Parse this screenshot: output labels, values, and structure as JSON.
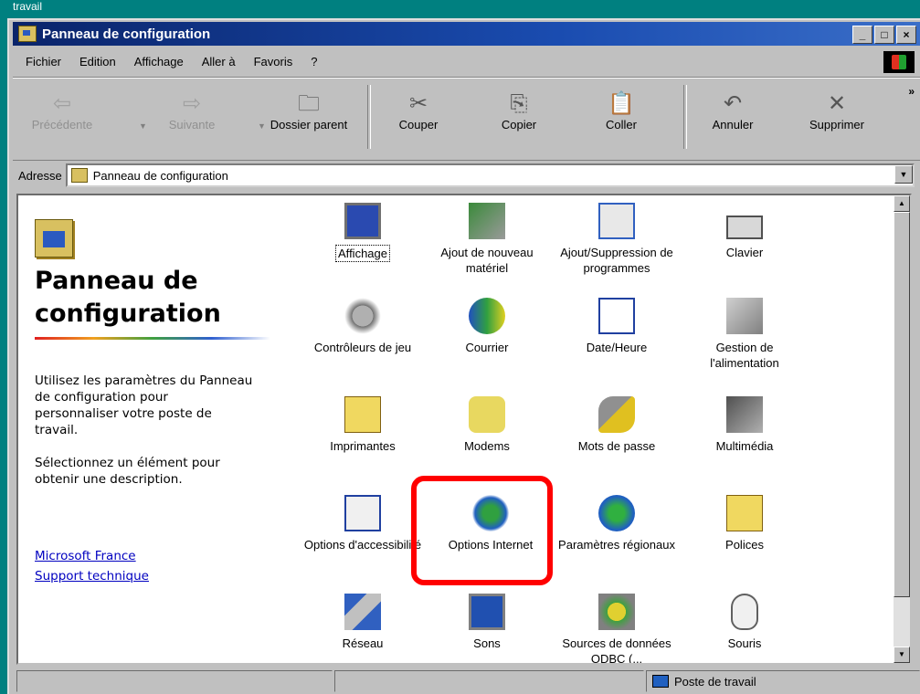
{
  "desktop": {
    "label": "travail"
  },
  "window": {
    "title": "Panneau de configuration",
    "min": "_",
    "max": "□",
    "close": "×"
  },
  "menu": [
    "Fichier",
    "Edition",
    "Affichage",
    "Aller à",
    "Favoris",
    "?"
  ],
  "toolbar": {
    "back": "Précédente",
    "forward": "Suivante",
    "up": "Dossier parent",
    "cut": "Couper",
    "copy": "Copier",
    "paste": "Coller",
    "undo": "Annuler",
    "delete": "Supprimer",
    "more": "»"
  },
  "address": {
    "label": "Adresse",
    "value": "Panneau de configuration"
  },
  "left": {
    "title": "Panneau de configuration",
    "desc1": "Utilisez les paramètres du Panneau de configuration pour personnaliser votre poste de travail.",
    "desc2": "Sélectionnez un élément pour obtenir une description.",
    "link1": "Microsoft France",
    "link2": "Support technique"
  },
  "items": [
    {
      "label": "Affichage",
      "icon": "monitor-icon"
    },
    {
      "label": "Ajout de nouveau matériel",
      "icon": "hardware-icon"
    },
    {
      "label": "Ajout/Suppression de programmes",
      "icon": "programs-icon"
    },
    {
      "label": "Clavier",
      "icon": "keyboard-icon"
    },
    {
      "label": "Contrôleurs de jeu",
      "icon": "joystick-icon"
    },
    {
      "label": "Courrier",
      "icon": "mail-icon"
    },
    {
      "label": "Date/Heure",
      "icon": "calendar-clock-icon"
    },
    {
      "label": "Gestion de l'alimentation",
      "icon": "power-plug-icon"
    },
    {
      "label": "Imprimantes",
      "icon": "printer-folder-icon"
    },
    {
      "label": "Modems",
      "icon": "telephone-icon"
    },
    {
      "label": "Mots de passe",
      "icon": "keys-icon"
    },
    {
      "label": "Multimédia",
      "icon": "multimedia-icon"
    },
    {
      "label": "Options d'accessibilité",
      "icon": "accessibility-icon"
    },
    {
      "label": "Options Internet",
      "icon": "globe-tools-icon"
    },
    {
      "label": "Paramètres régionaux",
      "icon": "globe-icon"
    },
    {
      "label": "Polices",
      "icon": "fonts-folder-icon"
    },
    {
      "label": "Réseau",
      "icon": "network-icon"
    },
    {
      "label": "Sons",
      "icon": "speaker-icon"
    },
    {
      "label": "Sources de données ODBC (...",
      "icon": "odbc-icon"
    },
    {
      "label": "Souris",
      "icon": "mouse-icon"
    }
  ],
  "status": {
    "zone": "Poste de travail"
  },
  "colors": {
    "titlebar": "#0a246a",
    "highlight": "#ff0000",
    "desktop": "#008080"
  }
}
